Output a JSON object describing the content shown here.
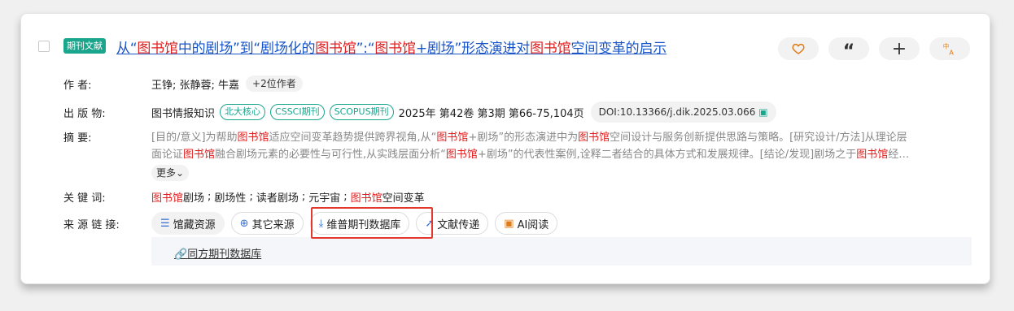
{
  "article": {
    "type_tag": "期刊文献",
    "title_parts": [
      "从“",
      "图书馆",
      "中的剧场”到“剧场化的",
      "图书馆",
      "”:“",
      "图书馆",
      "+剧场”形态演进对",
      "图书馆",
      "空间变革的启示"
    ]
  },
  "actions": {
    "favorite_icon": "heart-icon",
    "quote_label": "“",
    "add_label": "+",
    "translate_icon": "translate-icon"
  },
  "meta": {
    "author_label": "作 者:",
    "authors": "王铮; 张静蓉; 牛嘉",
    "more_authors": "+2位作者",
    "pub_label": "出 版 物:",
    "journal": "图书情报知识",
    "tags": [
      "北大核心",
      "CSSCI期刊",
      "SCOPUS期刊"
    ],
    "issue": "2025年 第42卷 第3期 第66-75,104页",
    "doi": "DOI:10.13366/j.dik.2025.03.066"
  },
  "abstract": {
    "label": "摘 要:",
    "line1_parts": [
      "[目的/意义]为帮助",
      "图书馆",
      "适应空间变革趋势提供跨界视角,从“",
      "图书馆",
      "+剧场”的形态演进中为",
      "图书馆",
      "空间设计与服务创新提供思路与策略。[研究设计/方法]从理论层"
    ],
    "line2_parts": [
      "面论证",
      "图书馆",
      "融合剧场元素的必要性与可行性,从实践层面分析“",
      "图书馆",
      "+剧场”的代表性案例,诠释二者结合的具体方式和发展规律。[结论/发现]剧场之于",
      "图书馆",
      "经…"
    ],
    "more_label": "更多"
  },
  "keywords": {
    "label": "关 键 词:",
    "items": [
      [
        "图书馆",
        "剧场"
      ],
      [
        "",
        "剧场性"
      ],
      [
        "",
        "读者剧场"
      ],
      [
        "",
        "元宇宙"
      ],
      [
        "图书馆",
        "空间变革"
      ]
    ]
  },
  "sources": {
    "label": "来 源 链 接:",
    "buttons": [
      "馆藏资源",
      "其它来源",
      "维普期刊数据库",
      "文献传递",
      "AI阅读"
    ],
    "db_link": "同方期刊数据库"
  }
}
